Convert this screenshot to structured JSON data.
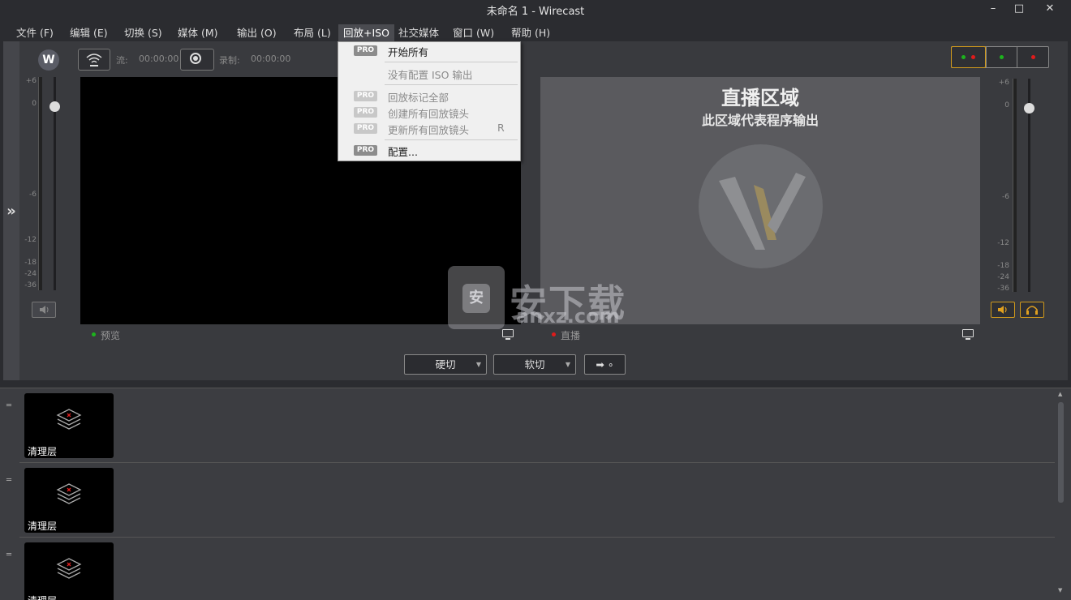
{
  "window": {
    "title": "未命名 1 - Wirecast",
    "minimize": "–",
    "maximize": "□",
    "close": "✕"
  },
  "menu": [
    {
      "label": "文件 (F)"
    },
    {
      "label": "编辑 (E)"
    },
    {
      "label": "切换 (S)"
    },
    {
      "label": "媒体 (M)"
    },
    {
      "label": "输出 (O)"
    },
    {
      "label": "布局 (L)"
    },
    {
      "label": "回放+ISO"
    },
    {
      "label": "社交媒体"
    },
    {
      "label": "窗口 (W)"
    },
    {
      "label": "帮助 (H)"
    }
  ],
  "dropdown": {
    "items": [
      {
        "label": "开始所有",
        "pro": "PRO",
        "disabled": false
      },
      {
        "label": "没有配置 ISO 输出",
        "pro": "",
        "disabled": true
      },
      {
        "label": "回放标记全部",
        "pro": "PRO",
        "disabled": true
      },
      {
        "label": "创建所有回放镜头",
        "pro": "PRO",
        "disabled": true
      },
      {
        "label": "更新所有回放镜头",
        "pro": "PRO",
        "disabled": true,
        "shortcut": "R"
      },
      {
        "label": "配置...",
        "pro": "PRO",
        "disabled": false
      }
    ]
  },
  "toolbar": {
    "stream_label": "流:",
    "stream_time": "00:00:00",
    "record_label": "录制:",
    "record_time": "00:00:00"
  },
  "meter_left": {
    "ticks": [
      "+6",
      "0",
      "-6",
      "-12",
      "-18",
      "-24",
      "-36"
    ]
  },
  "meter_right": {
    "ticks": [
      "+6",
      "0",
      "-6",
      "-12",
      "-18",
      "-24",
      "-36"
    ]
  },
  "preview": {
    "label": "预览",
    "dot_color": "#1db31d"
  },
  "live": {
    "title": "直播区域",
    "subtitle": "此区域代表程序输出",
    "label": "直播",
    "dot_color": "#e01b1b"
  },
  "transitions": {
    "cut": "硬切",
    "smooth": "软切",
    "go_symbol": "➡ ∘"
  },
  "status_lights": {
    "colors": [
      "#1db31d",
      "#e01b1b",
      "#1db31d",
      "#e01b1b"
    ]
  },
  "shots": [
    {
      "label": "清理层"
    },
    {
      "label": "清理层"
    },
    {
      "label": "清理层"
    }
  ],
  "watermark": {
    "text": "安下载",
    "sub": "anxz.com",
    "glyph": "安"
  },
  "colors": {
    "accent": "#d19a1c"
  }
}
